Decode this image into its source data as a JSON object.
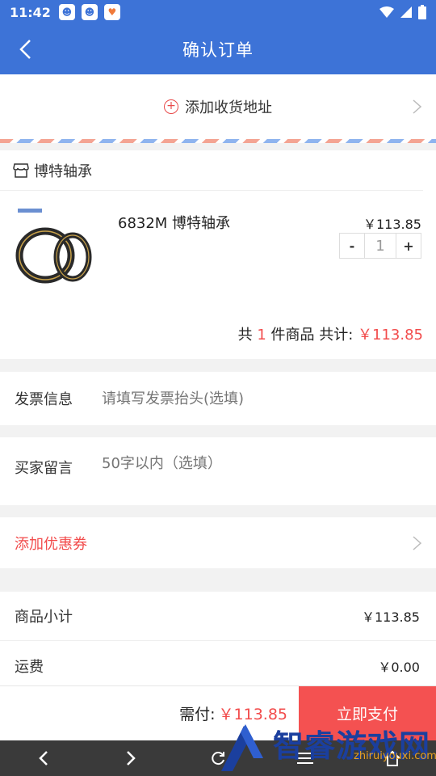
{
  "status_bar": {
    "time": "11:42"
  },
  "header": {
    "title": "确认订单"
  },
  "address": {
    "label": "添加收货地址"
  },
  "shop": {
    "name": "博特轴承",
    "product": {
      "name": "6832M 博特轴承",
      "price": "￥113.85",
      "quantity": "1",
      "minus": "-",
      "plus": "+"
    },
    "summary": {
      "prefix": "共 ",
      "count": "1",
      "mid": " 件商品 共计: ",
      "total": "￥113.85"
    }
  },
  "invoice": {
    "label": "发票信息",
    "placeholder": "请填写发票抬头(选填)"
  },
  "message": {
    "label": "买家留言",
    "placeholder": "50字以内（选填）"
  },
  "coupon": {
    "label": "添加优惠券"
  },
  "totals": {
    "subtotal_label": "商品小计",
    "subtotal_value": "￥113.85",
    "shipping_label": "运费",
    "shipping_value": "￥0.00"
  },
  "bottom": {
    "pay_label": "需付:",
    "pay_amount": "￥113.85",
    "pay_button": "立即支付"
  },
  "watermark": {
    "text": "智睿游戏网",
    "url": "zhiruiyouxi.com"
  },
  "colors": {
    "primary": "#3d73d7",
    "accent_red": "#f24c4c",
    "pay_button": "#f45151"
  }
}
